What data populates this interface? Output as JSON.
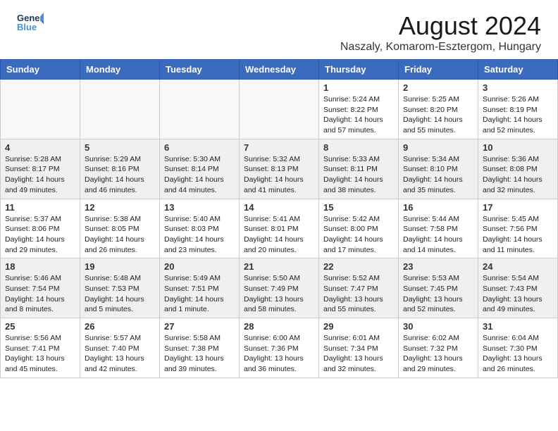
{
  "header": {
    "logo_line1": "General",
    "logo_line2": "Blue",
    "main_title": "August 2024",
    "subtitle": "Naszaly, Komarom-Esztergom, Hungary"
  },
  "weekdays": [
    "Sunday",
    "Monday",
    "Tuesday",
    "Wednesday",
    "Thursday",
    "Friday",
    "Saturday"
  ],
  "weeks": [
    [
      {
        "num": "",
        "info": ""
      },
      {
        "num": "",
        "info": ""
      },
      {
        "num": "",
        "info": ""
      },
      {
        "num": "",
        "info": ""
      },
      {
        "num": "1",
        "info": "Sunrise: 5:24 AM\nSunset: 8:22 PM\nDaylight: 14 hours\nand 57 minutes."
      },
      {
        "num": "2",
        "info": "Sunrise: 5:25 AM\nSunset: 8:20 PM\nDaylight: 14 hours\nand 55 minutes."
      },
      {
        "num": "3",
        "info": "Sunrise: 5:26 AM\nSunset: 8:19 PM\nDaylight: 14 hours\nand 52 minutes."
      }
    ],
    [
      {
        "num": "4",
        "info": "Sunrise: 5:28 AM\nSunset: 8:17 PM\nDaylight: 14 hours\nand 49 minutes."
      },
      {
        "num": "5",
        "info": "Sunrise: 5:29 AM\nSunset: 8:16 PM\nDaylight: 14 hours\nand 46 minutes."
      },
      {
        "num": "6",
        "info": "Sunrise: 5:30 AM\nSunset: 8:14 PM\nDaylight: 14 hours\nand 44 minutes."
      },
      {
        "num": "7",
        "info": "Sunrise: 5:32 AM\nSunset: 8:13 PM\nDaylight: 14 hours\nand 41 minutes."
      },
      {
        "num": "8",
        "info": "Sunrise: 5:33 AM\nSunset: 8:11 PM\nDaylight: 14 hours\nand 38 minutes."
      },
      {
        "num": "9",
        "info": "Sunrise: 5:34 AM\nSunset: 8:10 PM\nDaylight: 14 hours\nand 35 minutes."
      },
      {
        "num": "10",
        "info": "Sunrise: 5:36 AM\nSunset: 8:08 PM\nDaylight: 14 hours\nand 32 minutes."
      }
    ],
    [
      {
        "num": "11",
        "info": "Sunrise: 5:37 AM\nSunset: 8:06 PM\nDaylight: 14 hours\nand 29 minutes."
      },
      {
        "num": "12",
        "info": "Sunrise: 5:38 AM\nSunset: 8:05 PM\nDaylight: 14 hours\nand 26 minutes."
      },
      {
        "num": "13",
        "info": "Sunrise: 5:40 AM\nSunset: 8:03 PM\nDaylight: 14 hours\nand 23 minutes."
      },
      {
        "num": "14",
        "info": "Sunrise: 5:41 AM\nSunset: 8:01 PM\nDaylight: 14 hours\nand 20 minutes."
      },
      {
        "num": "15",
        "info": "Sunrise: 5:42 AM\nSunset: 8:00 PM\nDaylight: 14 hours\nand 17 minutes."
      },
      {
        "num": "16",
        "info": "Sunrise: 5:44 AM\nSunset: 7:58 PM\nDaylight: 14 hours\nand 14 minutes."
      },
      {
        "num": "17",
        "info": "Sunrise: 5:45 AM\nSunset: 7:56 PM\nDaylight: 14 hours\nand 11 minutes."
      }
    ],
    [
      {
        "num": "18",
        "info": "Sunrise: 5:46 AM\nSunset: 7:54 PM\nDaylight: 14 hours\nand 8 minutes."
      },
      {
        "num": "19",
        "info": "Sunrise: 5:48 AM\nSunset: 7:53 PM\nDaylight: 14 hours\nand 5 minutes."
      },
      {
        "num": "20",
        "info": "Sunrise: 5:49 AM\nSunset: 7:51 PM\nDaylight: 14 hours\nand 1 minute."
      },
      {
        "num": "21",
        "info": "Sunrise: 5:50 AM\nSunset: 7:49 PM\nDaylight: 13 hours\nand 58 minutes."
      },
      {
        "num": "22",
        "info": "Sunrise: 5:52 AM\nSunset: 7:47 PM\nDaylight: 13 hours\nand 55 minutes."
      },
      {
        "num": "23",
        "info": "Sunrise: 5:53 AM\nSunset: 7:45 PM\nDaylight: 13 hours\nand 52 minutes."
      },
      {
        "num": "24",
        "info": "Sunrise: 5:54 AM\nSunset: 7:43 PM\nDaylight: 13 hours\nand 49 minutes."
      }
    ],
    [
      {
        "num": "25",
        "info": "Sunrise: 5:56 AM\nSunset: 7:41 PM\nDaylight: 13 hours\nand 45 minutes."
      },
      {
        "num": "26",
        "info": "Sunrise: 5:57 AM\nSunset: 7:40 PM\nDaylight: 13 hours\nand 42 minutes."
      },
      {
        "num": "27",
        "info": "Sunrise: 5:58 AM\nSunset: 7:38 PM\nDaylight: 13 hours\nand 39 minutes."
      },
      {
        "num": "28",
        "info": "Sunrise: 6:00 AM\nSunset: 7:36 PM\nDaylight: 13 hours\nand 36 minutes."
      },
      {
        "num": "29",
        "info": "Sunrise: 6:01 AM\nSunset: 7:34 PM\nDaylight: 13 hours\nand 32 minutes."
      },
      {
        "num": "30",
        "info": "Sunrise: 6:02 AM\nSunset: 7:32 PM\nDaylight: 13 hours\nand 29 minutes."
      },
      {
        "num": "31",
        "info": "Sunrise: 6:04 AM\nSunset: 7:30 PM\nDaylight: 13 hours\nand 26 minutes."
      }
    ]
  ]
}
